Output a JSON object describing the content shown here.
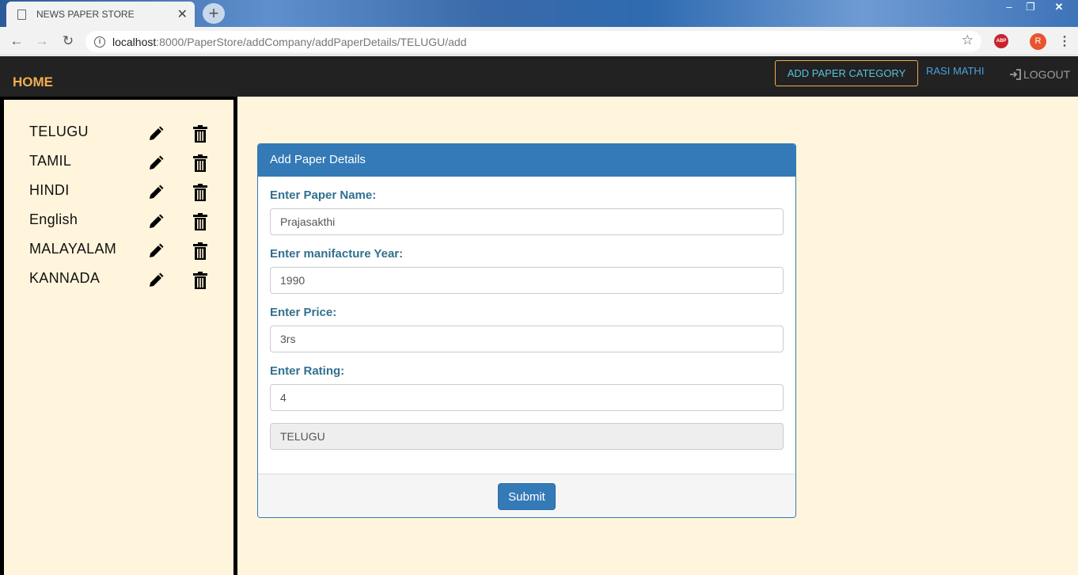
{
  "browser": {
    "tab_title": "NEWS PAPER STORE",
    "tab_close": "✕",
    "new_tab": "+",
    "url_host": "localhost",
    "url_rest": ":8000/PaperStore/addCompany/addPaperDetails/TELUGU/add",
    "abp_label": "ABP",
    "avatar_letter": "R",
    "window_min": "–",
    "window_max": "❐",
    "window_close": "✕"
  },
  "navbar": {
    "home": "HOME",
    "add_category": "ADD PAPER CATEGORY",
    "user": "RASI MATHI",
    "logout": "LOGOUT"
  },
  "sidebar": {
    "categories": [
      {
        "name": "TELUGU"
      },
      {
        "name": "TAMIL"
      },
      {
        "name": "HINDI"
      },
      {
        "name": "English"
      },
      {
        "name": "MALAYALAM"
      },
      {
        "name": "KANNADA"
      }
    ]
  },
  "form": {
    "heading": "Add Paper Details",
    "paper_name_label": "Enter Paper Name:",
    "paper_name_value": "Prajasakthi",
    "year_label": "Enter manifacture Year:",
    "year_value": "1990",
    "price_label": "Enter Price:",
    "price_value": "3rs",
    "rating_label": "Enter Rating:",
    "rating_value": "4",
    "category_value": "TELUGU",
    "submit": "Submit"
  },
  "colors": {
    "navbar_bg": "#222222",
    "accent_orange": "#f0ad4e",
    "primary_blue": "#337ab7",
    "page_bg": "#fff5dc"
  }
}
